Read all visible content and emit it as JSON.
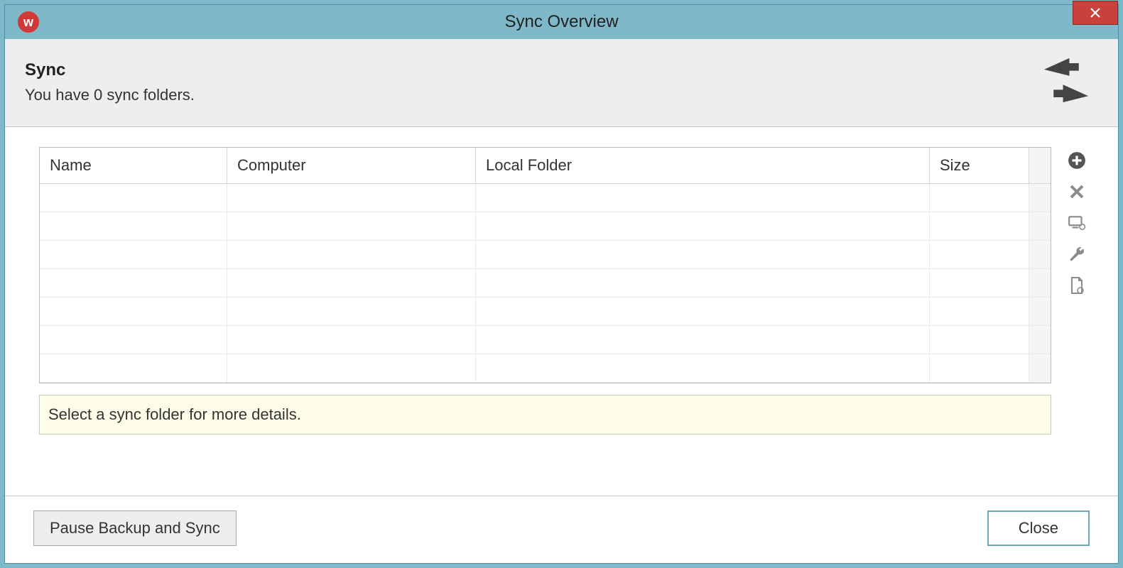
{
  "window": {
    "title": "Sync Overview",
    "app_icon_letter": "w"
  },
  "header": {
    "title": "Sync",
    "subtitle": "You have 0 sync folders."
  },
  "table": {
    "columns": {
      "name": "Name",
      "computer": "Computer",
      "local_folder": "Local Folder",
      "size": "Size"
    },
    "rows": []
  },
  "info_bar": "Select a sync folder for more details.",
  "side_tools": {
    "add": "add",
    "remove": "remove",
    "computer": "computer-settings",
    "settings": "settings",
    "document": "document"
  },
  "footer": {
    "pause": "Pause Backup and Sync",
    "close": "Close"
  }
}
